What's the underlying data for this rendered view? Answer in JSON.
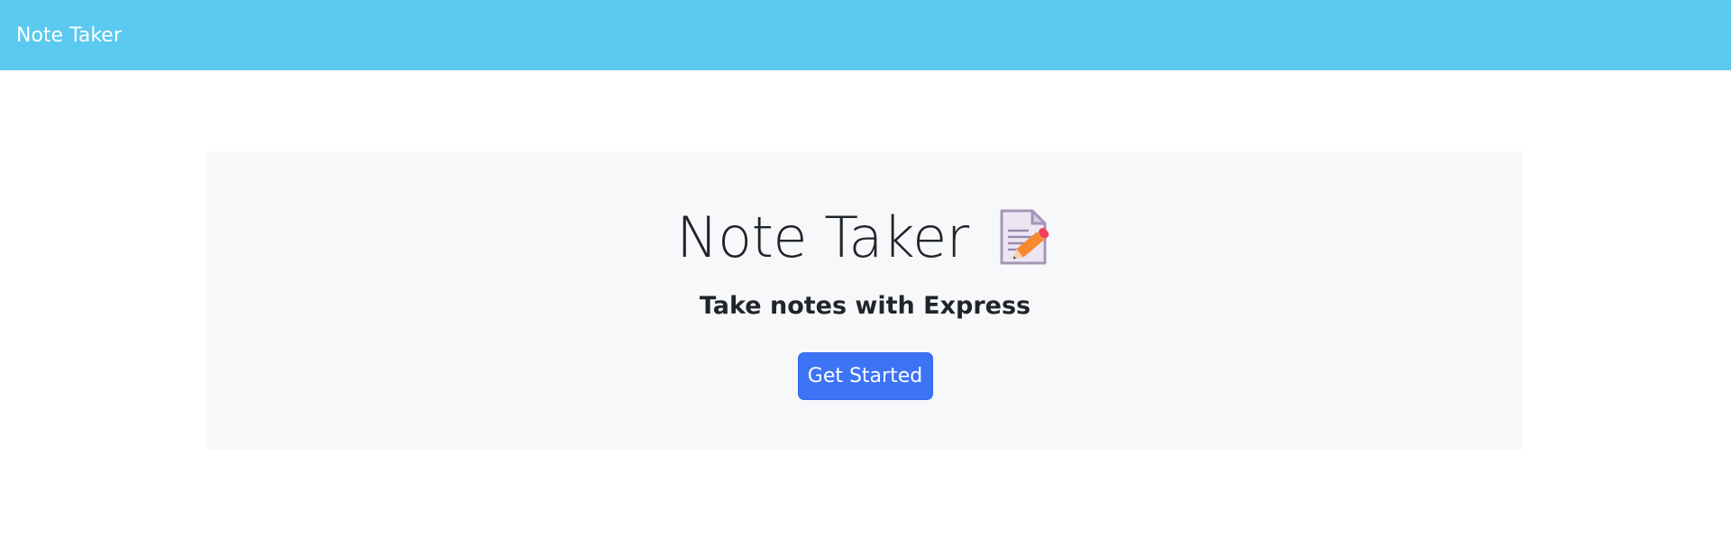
{
  "navbar": {
    "brand": "Note Taker",
    "background_color": "#5bc9f0"
  },
  "hero": {
    "title": "Note Taker",
    "title_icon": "memo-icon",
    "subtitle": "Take notes with Express",
    "button_label": "Get Started",
    "button_color": "#3d73f5",
    "panel_color": "#f7f8fa"
  }
}
